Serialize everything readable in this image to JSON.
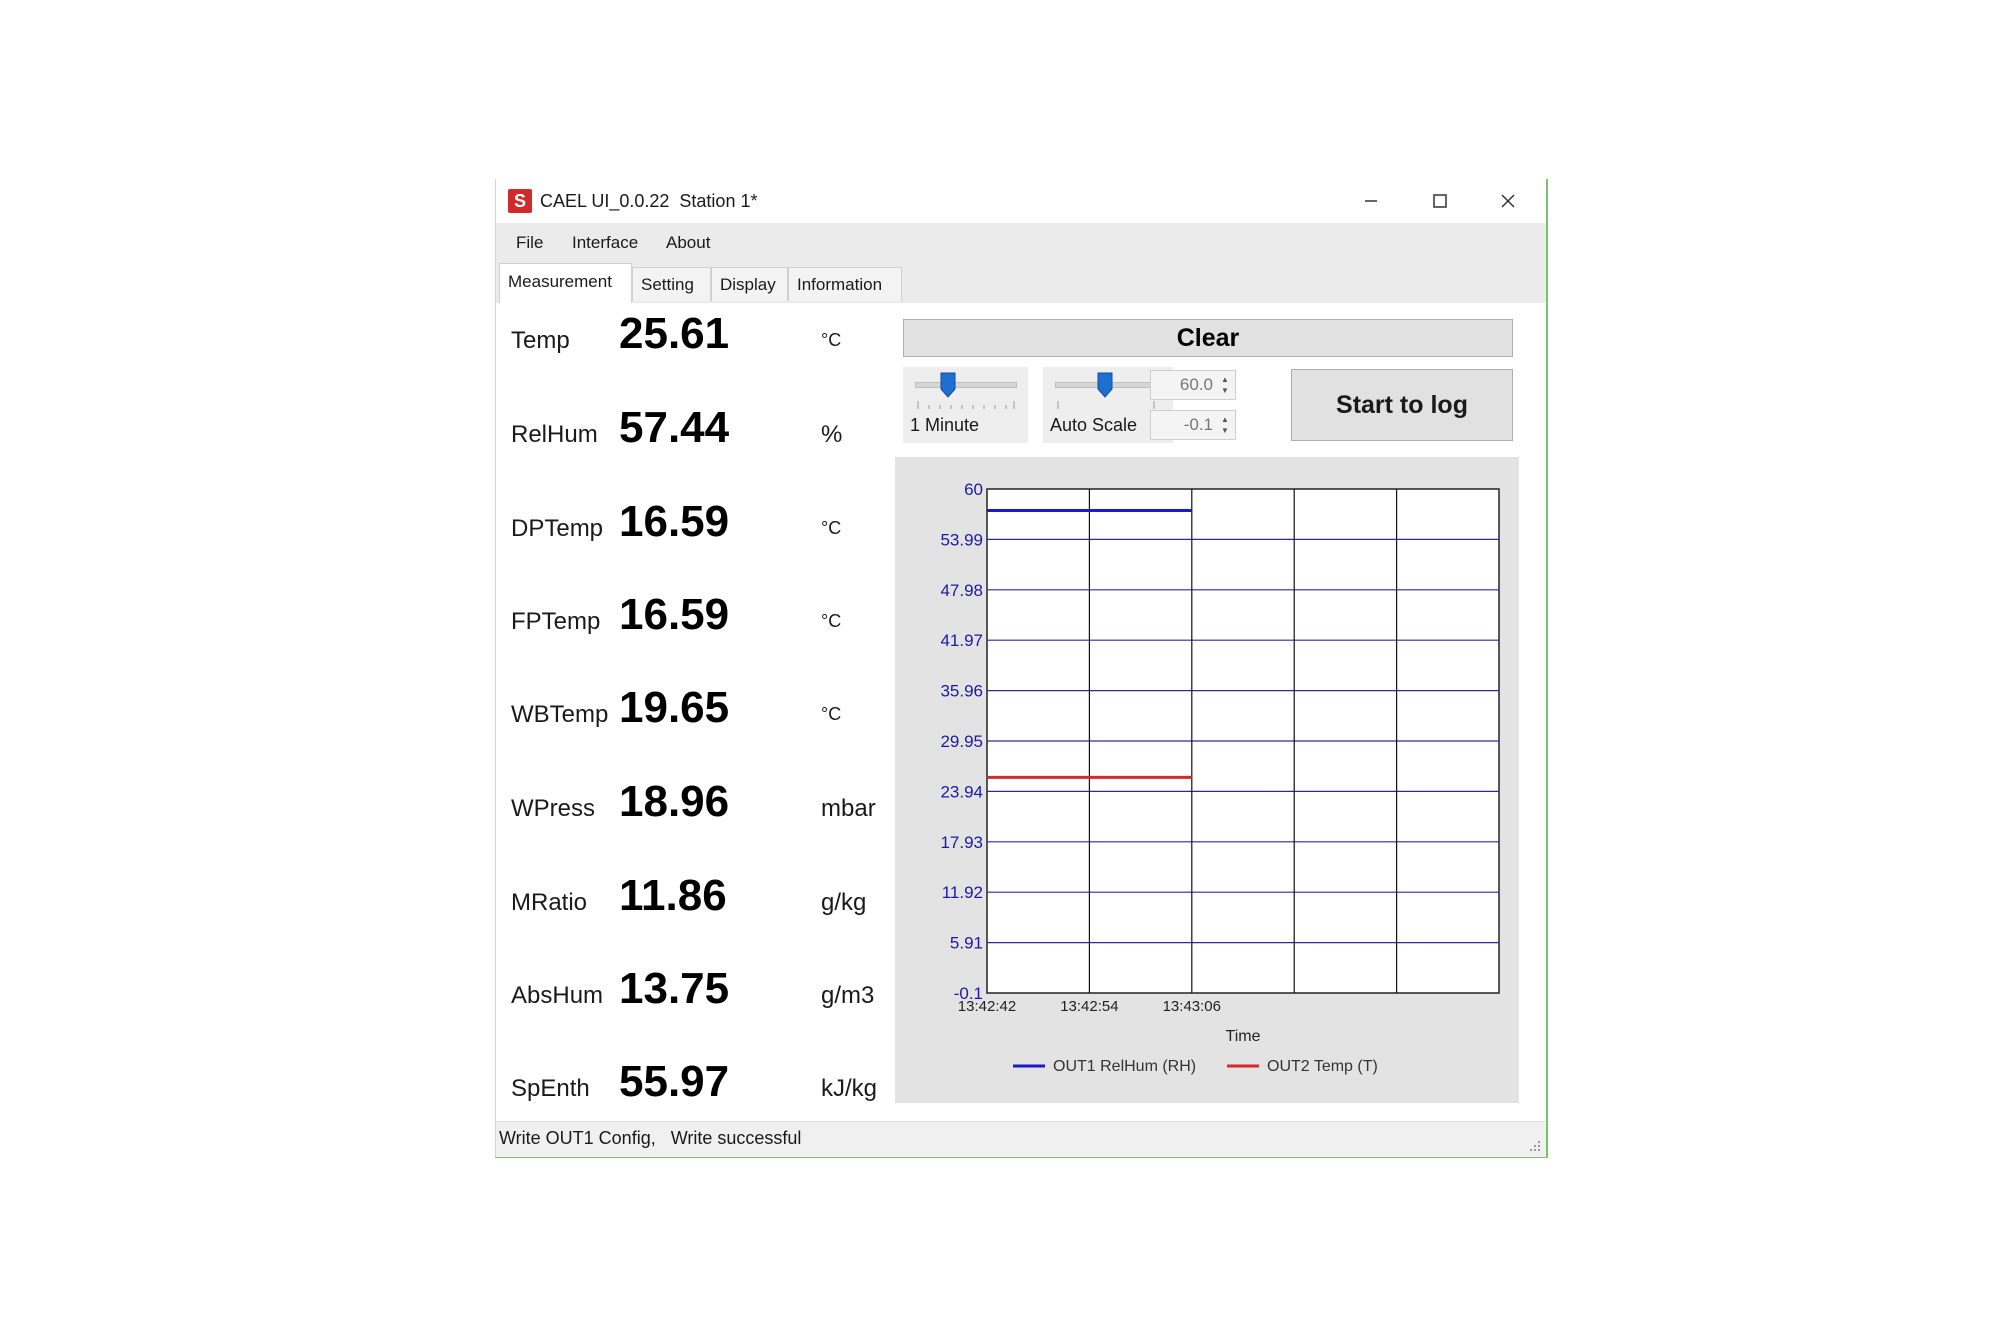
{
  "window": {
    "title": "CAEL UI_0.0.22  Station 1*",
    "icon": "app-logo-icon",
    "controls": [
      "minimize-icon",
      "maximize-icon",
      "close-icon"
    ]
  },
  "menu": {
    "file": "File",
    "interface": "Interface",
    "about": "About"
  },
  "tabs": [
    {
      "label": "Measurement",
      "active": true
    },
    {
      "label": "Setting"
    },
    {
      "label": "Display"
    },
    {
      "label": "Information"
    }
  ],
  "measurements": [
    {
      "label": "Temp",
      "value": "25.61",
      "unit": "°C"
    },
    {
      "label": "RelHum",
      "value": "57.44",
      "unit": "%"
    },
    {
      "label": "DPTemp",
      "value": "16.59",
      "unit": "°C"
    },
    {
      "label": "FPTemp",
      "value": "16.59",
      "unit": "°C"
    },
    {
      "label": "WBTemp",
      "value": "19.65",
      "unit": "°C"
    },
    {
      "label": "WPress",
      "value": "18.96",
      "unit": "mbar"
    },
    {
      "label": "MRatio",
      "value": "11.86",
      "unit": "g/kg"
    },
    {
      "label": "AbsHum",
      "value": "13.75",
      "unit": "g/m3"
    },
    {
      "label": "SpEnth",
      "value": "55.97",
      "unit": "kJ/kg"
    }
  ],
  "controls": {
    "clear_label": "Clear",
    "time_slider": {
      "label": "1 Minute",
      "position": 0.33
    },
    "scale_slider": {
      "label": "Auto Scale",
      "position": 0.5
    },
    "max_spin": "60.0",
    "min_spin": "-0.1",
    "start_label": "Start to log"
  },
  "chart_data": {
    "type": "line",
    "xlabel": "Time",
    "ylabel": "",
    "ylim": [
      -0.1,
      60
    ],
    "y_ticks": [
      "60",
      "53.99",
      "47.98",
      "41.97",
      "35.96",
      "29.95",
      "23.94",
      "17.93",
      "11.92",
      "5.91",
      "-0.1"
    ],
    "x_ticks": [
      "13:42:42",
      "13:42:54",
      "13:43:06"
    ],
    "x": [
      "13:42:42",
      "13:43:06"
    ],
    "grid": true,
    "legend_position": "bottom",
    "series": [
      {
        "name": "OUT1 RelHum (RH)",
        "color": "#1a1acc",
        "values": [
          57.44,
          57.44
        ]
      },
      {
        "name": "OUT2 Temp (T)",
        "color": "#d42a2a",
        "values": [
          25.61,
          25.61
        ]
      }
    ]
  },
  "status": {
    "text": "Write OUT1 Config,   Write successful"
  },
  "colors": {
    "axis_text": "#1a1aaa",
    "grid_line": "#2a2a9a",
    "frame_accent": "#7dbf6a"
  }
}
